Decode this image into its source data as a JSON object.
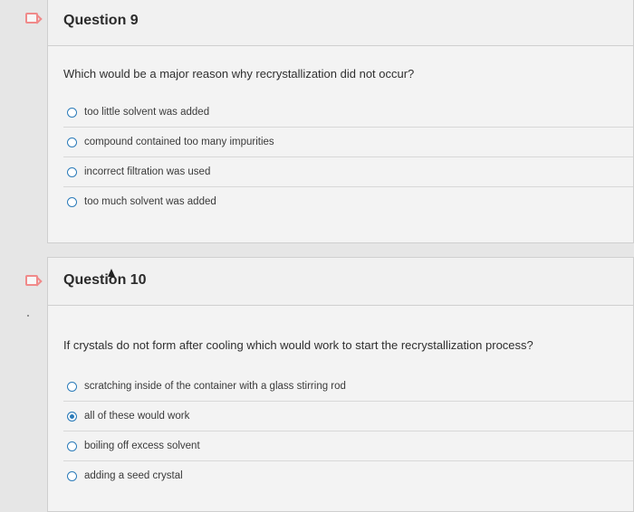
{
  "questions": [
    {
      "title": "Question 9",
      "text": "Which would be a major reason why recrystallization did not occur?",
      "answers": [
        {
          "label": "too little solvent was added",
          "selected": false
        },
        {
          "label": "compound contained too many impurities",
          "selected": false
        },
        {
          "label": "incorrect filtration was used",
          "selected": false
        },
        {
          "label": "too much solvent was added",
          "selected": false
        }
      ]
    },
    {
      "title": "Question 10",
      "text": "If crystals do not form after cooling which would work to start the recrystallization process?",
      "answers": [
        {
          "label": "scratching inside of the container with a glass stirring rod",
          "selected": false
        },
        {
          "label": "all of these would work",
          "selected": true
        },
        {
          "label": "boiling off excess solvent",
          "selected": false
        },
        {
          "label": "adding a seed crystal",
          "selected": false
        }
      ]
    }
  ],
  "colors": {
    "flag": "#f08a8a",
    "radio": "#2b7bb9"
  }
}
